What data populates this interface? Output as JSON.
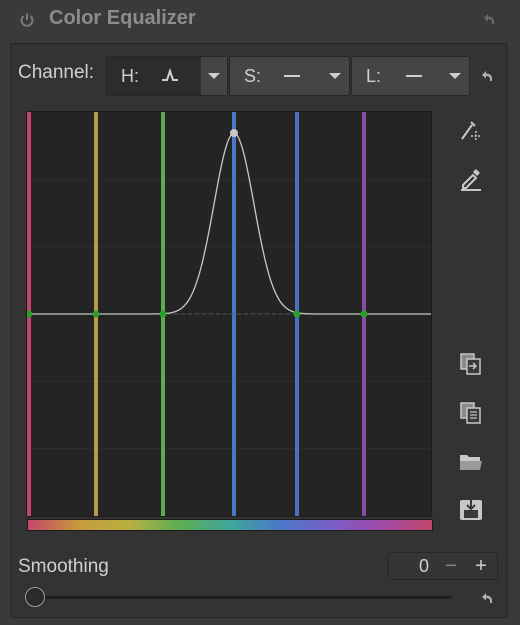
{
  "module": {
    "title": "Color Equalizer"
  },
  "channel": {
    "label": "Channel:",
    "segments": [
      {
        "key": "H:",
        "curve": "bump",
        "active": true
      },
      {
        "key": "S:",
        "curve": "flat",
        "active": false
      },
      {
        "key": "L:",
        "curve": "flat",
        "active": false
      }
    ]
  },
  "graph": {
    "hue_lines": [
      {
        "hue": "red",
        "color": "#c0446c"
      },
      {
        "hue": "orange",
        "color": "#b89a48"
      },
      {
        "hue": "green",
        "color": "#5eaa4e"
      },
      {
        "hue": "blue",
        "color": "#4a78c0"
      },
      {
        "hue": "blue2",
        "color": "#4a70c0"
      },
      {
        "hue": "magenta",
        "color": "#8a4aa8"
      }
    ],
    "curve_values": [
      0,
      0,
      0,
      1,
      0,
      0
    ],
    "node_color": "#2aa02a",
    "curve_color": "#c8c8c8"
  },
  "side_tools": [
    {
      "icon": "color-picker-area-icon"
    },
    {
      "icon": "eyedropper-icon"
    },
    {
      "icon": "copy-icon"
    },
    {
      "icon": "paste-icon"
    },
    {
      "icon": "folder-open-icon"
    },
    {
      "icon": "save-icon"
    }
  ],
  "smoothing": {
    "label": "Smoothing",
    "value": "0",
    "minus": "−",
    "plus": "+",
    "slider_fraction": 0
  }
}
